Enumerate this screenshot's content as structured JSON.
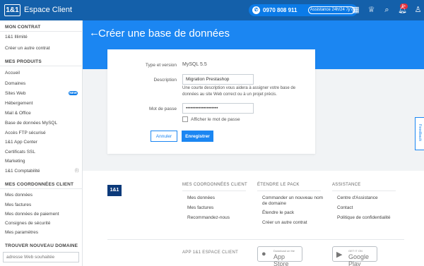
{
  "header": {
    "logo": "1&1",
    "app_name": "Espace Client",
    "phone": "0970 808 911",
    "assist": "Assistance 24h/24 7j/7",
    "notif_count": "9+",
    "icons": [
      "grid-icon",
      "crown-icon",
      "search-icon",
      "bell-icon",
      "user-icon"
    ]
  },
  "sidebar": {
    "contract_head": "MON CONTRAT",
    "contract_items": [
      "1&1 Illimité",
      "Créer un autre contrat"
    ],
    "products_head": "MES PRODUITS",
    "product_items": [
      "Accueil",
      "Domaines",
      "Sites Web",
      "Hébergement",
      "Mail & Office",
      "Base de données MySQL",
      "Accès FTP sécurisé",
      "1&1 App Center",
      "Certificats SSL",
      "Marketing",
      "1&1 Comptabilité"
    ],
    "new_badge": "NEW",
    "help_mark": "(i)",
    "coords_head": "MES COORDONNÉES CLIENT",
    "coords_items": [
      "Mes données",
      "Mes factures",
      "Mes données de paiement",
      "Consignes de sécurité",
      "Mes paramètres"
    ],
    "domain_head": "TROUVER NOUVEAU DOMAINE",
    "domain_placeholder": "adresse Web souhaitée"
  },
  "page": {
    "title": "Créer une base de données",
    "back_icon": "back-arrow-icon"
  },
  "form": {
    "type_label": "Type et version",
    "type_value": "MySQL 5.5",
    "desc_label": "Description",
    "desc_value": "Migration Prestashop",
    "desc_help": "Une courte description vous aidera à assigner votre base de données au site Web correct ou à un projet précis.",
    "pwd_label": "Mot de passe",
    "pwd_value": "••••••••••••••••••••",
    "show_pwd_label": "Afficher le mot de passe",
    "cancel": "Annuler",
    "save": "Enregistrer"
  },
  "feedback": "Feedback",
  "footer": {
    "logo": "1&1",
    "col1_head": "MES COORDONNÉES CLIENT",
    "col1_items": [
      "Mes données",
      "Mes factures",
      "Recommandez-nous"
    ],
    "col2_head": "ÉTENDRE LE PACK",
    "col2_items": [
      "Commander un nouveau nom",
      "de domaine",
      "Étendre le pack",
      "Créer un autre contrat"
    ],
    "col3_head": "ASSISTANCE",
    "col3_items": [
      "Centre d'Assistance",
      "Contact",
      "Politique de confidentialité"
    ],
    "app_label": "APP 1&1 ESPACE CLIENT",
    "appstore_small": "Download on the",
    "appstore_big": "App Store",
    "googleplay_small": "GET IT ON",
    "googleplay_big": "Google Play"
  },
  "colors": {
    "topbar": "#1460aa",
    "hero": "#1b86f2",
    "accent": "#0b7be8"
  }
}
